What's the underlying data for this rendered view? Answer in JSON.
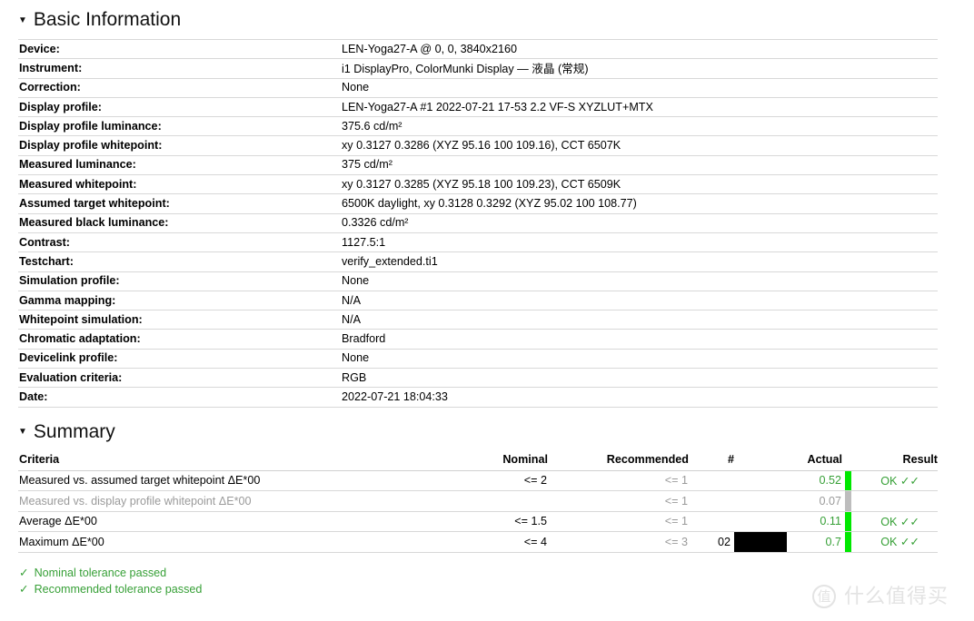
{
  "basic": {
    "heading": "Basic Information",
    "toggle_icon": "▼",
    "rows": [
      {
        "label": "Device:",
        "value": "LEN-Yoga27-A @ 0, 0, 3840x2160"
      },
      {
        "label": "Instrument:",
        "value": "i1 DisplayPro, ColorMunki Display — 液晶 (常规)"
      },
      {
        "label": "Correction:",
        "value": "None"
      },
      {
        "label": "Display profile:",
        "value": "LEN-Yoga27-A #1 2022-07-21 17-53 2.2 VF-S XYZLUT+MTX"
      },
      {
        "label": "Display profile luminance:",
        "value": "375.6 cd/m²"
      },
      {
        "label": "Display profile whitepoint:",
        "value": "xy 0.3127 0.3286 (XYZ 95.16 100 109.16), CCT 6507K"
      },
      {
        "label": "Measured luminance:",
        "value": "375 cd/m²"
      },
      {
        "label": "Measured whitepoint:",
        "value": "xy 0.3127 0.3285 (XYZ 95.18 100 109.23), CCT 6509K"
      },
      {
        "label": "Assumed target whitepoint:",
        "value": "6500K daylight, xy 0.3128 0.3292 (XYZ 95.02 100 108.77)"
      },
      {
        "label": "Measured black luminance:",
        "value": "0.3326 cd/m²"
      },
      {
        "label": "Contrast:",
        "value": "1127.5:1"
      },
      {
        "label": "Testchart:",
        "value": "verify_extended.ti1"
      },
      {
        "label": "Simulation profile:",
        "value": "None"
      },
      {
        "label": "Gamma mapping:",
        "value": "N/A"
      },
      {
        "label": "Whitepoint simulation:",
        "value": "N/A"
      },
      {
        "label": "Chromatic adaptation:",
        "value": "Bradford"
      },
      {
        "label": "Devicelink profile:",
        "value": "None"
      },
      {
        "label": "Evaluation criteria:",
        "value": "RGB"
      },
      {
        "label": "Date:",
        "value": "2022-07-21 18:04:33"
      }
    ]
  },
  "summary": {
    "heading": "Summary",
    "toggle_icon": "▼",
    "columns": {
      "criteria": "Criteria",
      "nominal": "Nominal",
      "recommended": "Recommended",
      "number": "#",
      "actual": "Actual",
      "result": "Result"
    },
    "rows": [
      {
        "criteria": "Measured vs. assumed target whitepoint ΔE*00",
        "nominal": "<= 2",
        "recommended": "<= 1",
        "number": "",
        "swatch": "",
        "actual": "0.52",
        "indicator": "pass",
        "result": "OK ✓✓"
      },
      {
        "criteria": "Measured vs. display profile whitepoint ΔE*00",
        "nominal": "",
        "recommended": "<= 1",
        "number": "",
        "swatch": "",
        "actual": "0.07",
        "indicator": "none",
        "result": ""
      },
      {
        "criteria": "Average ΔE*00",
        "nominal": "<= 1.5",
        "recommended": "<= 1",
        "number": "",
        "swatch": "",
        "actual": "0.11",
        "indicator": "pass",
        "result": "OK ✓✓"
      },
      {
        "criteria": "Maximum ΔE*00",
        "nominal": "<= 4",
        "recommended": "<= 3",
        "number": "02",
        "swatch": "#000000",
        "actual": "0.7",
        "indicator": "pass",
        "result": "OK ✓✓"
      }
    ],
    "notes": [
      {
        "check": "✓",
        "text": "Nominal tolerance passed"
      },
      {
        "check": "✓",
        "text": "Recommended tolerance passed"
      }
    ]
  },
  "watermark": {
    "logo_text": "值",
    "text": "什么值得买"
  },
  "colors": {
    "pass_green": "#37a037",
    "indicator_green": "#00e800",
    "indicator_grey": "#bdbdbd",
    "dim_text": "#9a9a9a"
  }
}
